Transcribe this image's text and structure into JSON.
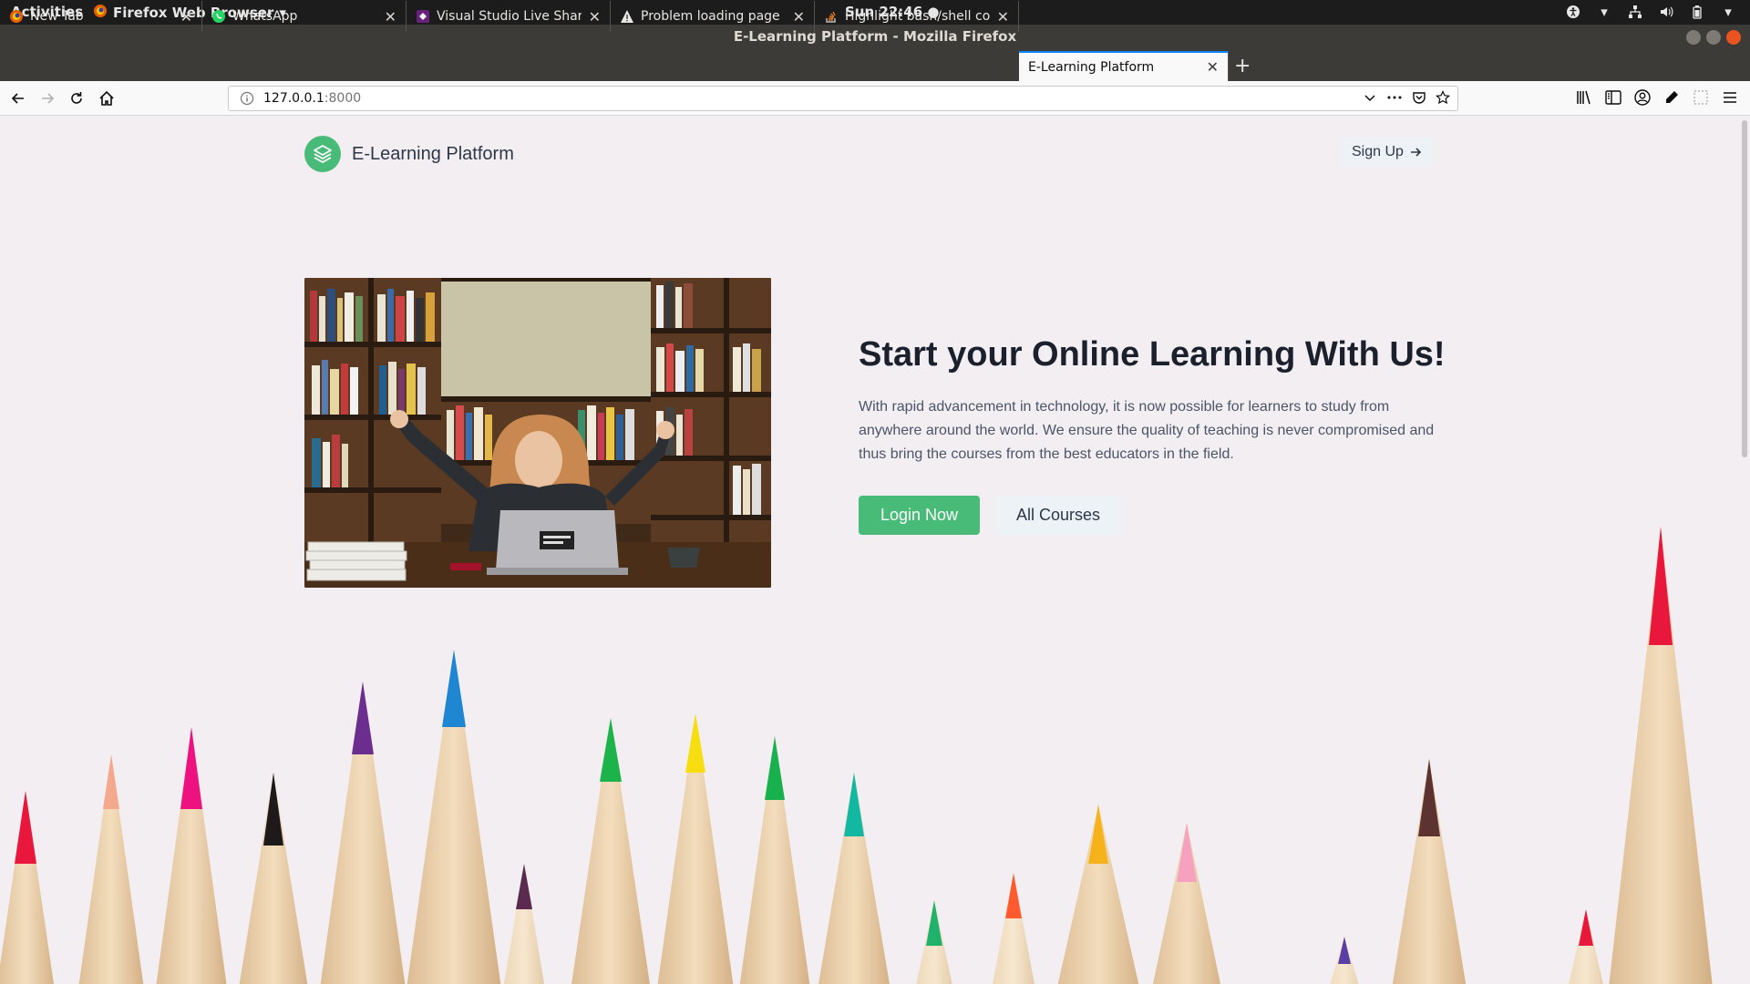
{
  "system": {
    "activities": "Activities",
    "app_menu": "Firefox Web Browser",
    "clock": "Sun 22:46",
    "tray_icons": [
      "accessibility-icon",
      "network-icon",
      "volume-icon",
      "battery-icon",
      "system-menu-icon"
    ]
  },
  "window": {
    "title": "E-Learning Platform - Mozilla Firefox"
  },
  "tabs": [
    {
      "label": "New Tab",
      "icon": "firefox-icon",
      "active": false
    },
    {
      "label": "WhatsApp",
      "icon": "whatsapp-icon",
      "active": false
    },
    {
      "label": "Visual Studio Live Share",
      "icon": "vs-liveshare-icon",
      "active": false
    },
    {
      "label": "Problem loading page",
      "icon": "warning-icon",
      "active": false
    },
    {
      "label": "Highlight bash/shell cod",
      "icon": "stackoverflow-icon",
      "active": false
    },
    {
      "label": "E-Learning Platform",
      "icon": "",
      "active": true
    }
  ],
  "navbar": {
    "url_host": "127.0.0.1",
    "url_port": ":8000"
  },
  "page": {
    "brand": "E-Learning Platform",
    "signup": "Sign Up",
    "hero_title": "Start your Online Learning With Us!",
    "hero_description": "With rapid advancement in technology, it is now possible for learners to study from anywhere around the world. We ensure the quality of teaching is never compromised and thus bring the courses from the best educators in the field.",
    "login_button": "Login Now",
    "courses_button": "All Courses"
  },
  "colors": {
    "accent": "#48bb78",
    "page_bg": "#f3eef2",
    "title_text": "#1a202c",
    "body_text": "#4a5568",
    "firefox_blue": "#0a84ff"
  }
}
